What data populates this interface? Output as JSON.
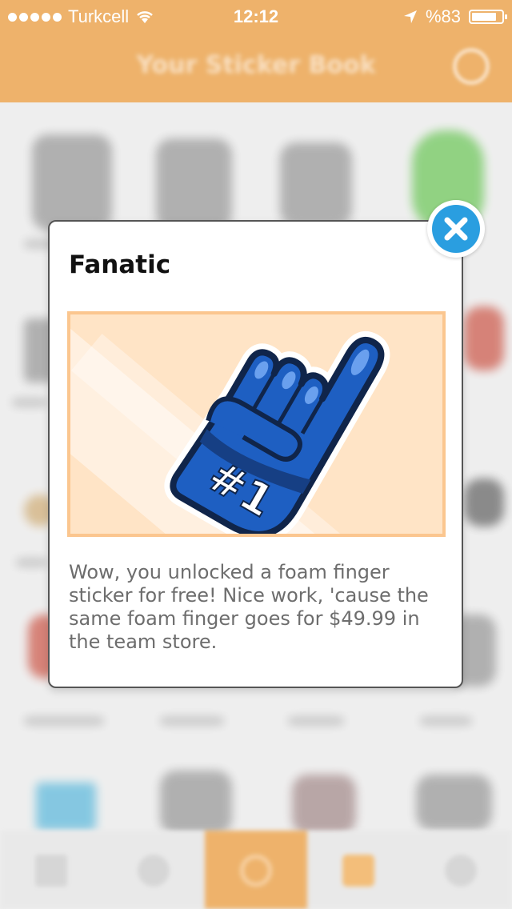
{
  "status_bar": {
    "carrier": "Turkcell",
    "time": "12:12",
    "battery_text": "%83",
    "battery_level": 0.83
  },
  "header": {
    "title": "Your Sticker Book"
  },
  "modal": {
    "title": "Fanatic",
    "sticker": {
      "icon": "foam-finger",
      "text": "#1"
    },
    "description": "Wow, you unlocked a foam finger sticker for free! Nice work, 'cause the same foam finger goes for $49.99 in the team store."
  },
  "tab_bar": {
    "items": [
      {
        "icon": "grid-icon"
      },
      {
        "icon": "gear-icon"
      },
      {
        "icon": "play-icon",
        "active": true
      },
      {
        "icon": "sticker-book-icon"
      },
      {
        "icon": "profile-icon"
      }
    ]
  },
  "colors": {
    "accent": "#e8993a",
    "close_button": "#2a9ee0",
    "sticker_blue": "#1e5fc2",
    "sticker_frame": "#fbc68f"
  }
}
